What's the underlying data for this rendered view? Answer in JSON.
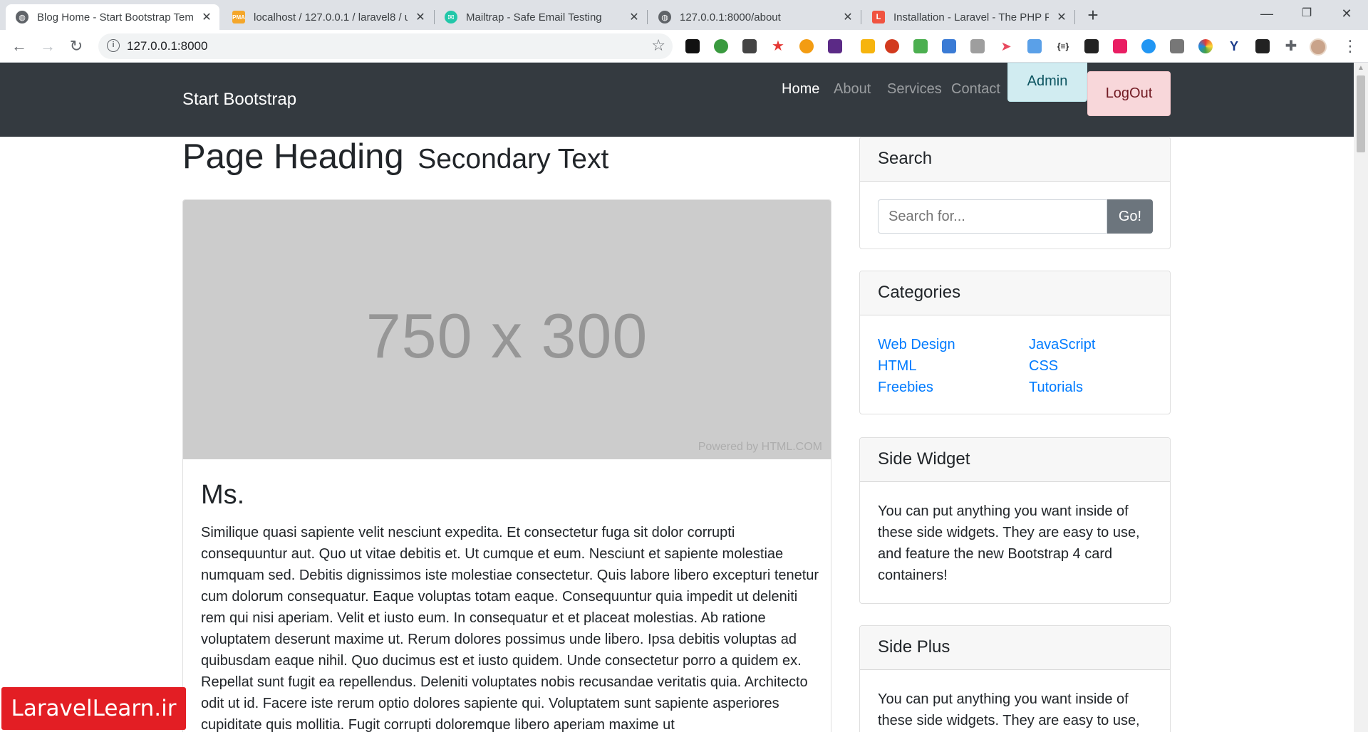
{
  "browser": {
    "tabs": [
      {
        "label": "Blog Home - Start Bootstrap Tem",
        "icon": "globe-icon"
      },
      {
        "label": "localhost / 127.0.0.1 / laravel8 / u",
        "icon": "phpmyadmin-icon"
      },
      {
        "label": "Mailtrap - Safe Email Testing",
        "icon": "mailtrap-icon"
      },
      {
        "label": "127.0.0.1:8000/about",
        "icon": "globe-icon"
      },
      {
        "label": "Installation - Laravel - The PHP Fr",
        "icon": "laravel-icon"
      }
    ],
    "url": "127.0.0.1:8000",
    "extension_badges": {
      "puzzle_count": "9",
      "note_count": "4"
    }
  },
  "nav": {
    "brand": "Start Bootstrap",
    "links": [
      "Home",
      "About",
      "Services",
      "Contact"
    ],
    "admin_label": "Admin",
    "logout_label": "LogOut"
  },
  "page": {
    "heading": "Page Heading",
    "subheading": "Secondary Text"
  },
  "post": {
    "image_text": "750 x 300",
    "image_credit": "Powered by HTML.COM",
    "title": "Ms.",
    "body": "Similique quasi sapiente velit nesciunt expedita. Et consectetur fuga sit dolor corrupti consequuntur aut. Quo ut vitae debitis et. Ut cumque et eum. Nesciunt et sapiente molestiae numquam sed. Debitis dignissimos iste molestiae consectetur. Quis labore libero excepturi tenetur cum dolorum consequatur. Eaque voluptas totam eaque. Consequuntur quia impedit ut deleniti rem qui nisi aperiam. Velit et iusto eum. In consequatur et et placeat molestias. Ab ratione voluptatem deserunt maxime ut. Rerum dolores possimus unde libero. Ipsa debitis voluptas ad quibusdam eaque nihil. Quo ducimus est et iusto quidem. Unde consectetur porro a quidem ex. Repellat sunt fugit ea repellendus. Deleniti voluptates nobis recusandae veritatis quia. Architecto odit ut id. Facere iste rerum optio dolores sapiente qui. Voluptatem sunt sapiente asperiores cupiditate quis mollitia. Fugit corrupti doloremque libero aperiam maxime ut"
  },
  "sidebar": {
    "search": {
      "title": "Search",
      "placeholder": "Search for...",
      "button": "Go!"
    },
    "categories": {
      "title": "Categories",
      "items": [
        "Web Design",
        "JavaScript",
        "HTML",
        "CSS",
        "Freebies",
        "Tutorials"
      ]
    },
    "side_widget": {
      "title": "Side Widget",
      "text": "You can put anything you want inside of these side widgets. They are easy to use, and feature the new Bootstrap 4 card containers!"
    },
    "side_plus": {
      "title": "Side Plus",
      "text": "You can put anything you want inside of these side widgets. They are easy to use,"
    }
  },
  "watermark": "LaravelLearn.ir",
  "colors": {
    "navbar": "#343a40",
    "link": "#007bff",
    "admin_bg": "#d1ecf1",
    "logout_bg": "#f8d7da",
    "watermark_bg": "#e31e24"
  }
}
